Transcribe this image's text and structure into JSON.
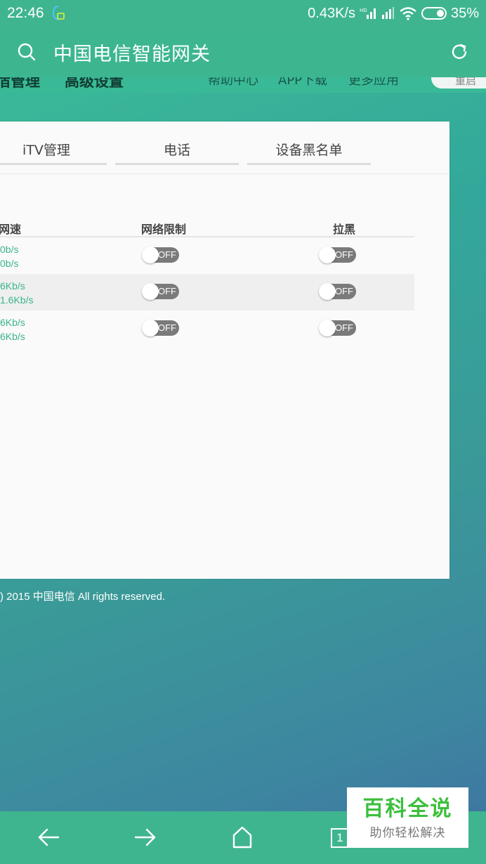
{
  "status_bar": {
    "time": "22:46",
    "net_speed": "0.43K/s",
    "battery": "35%"
  },
  "address_bar": {
    "title": "中国电信智能网关"
  },
  "page_nav": {
    "items": [
      "宿管理",
      "高级设置",
      "帮助中心",
      "APP下载",
      "更多应用"
    ],
    "pill": "重启"
  },
  "tabs": [
    "iTV管理",
    "电话",
    "设备黑名单"
  ],
  "table": {
    "headers": {
      "speed": "网速",
      "limit": "网络限制",
      "block": "拉黑"
    },
    "rows": [
      {
        "speed_up": "0b/s",
        "speed_down": "0b/s",
        "limit": "OFF",
        "block": "OFF"
      },
      {
        "speed_up": "6Kb/s",
        "speed_down": "1.6Kb/s",
        "limit": "OFF",
        "block": "OFF"
      },
      {
        "speed_up": "6Kb/s",
        "speed_down": "6Kb/s",
        "limit": "OFF",
        "block": "OFF"
      }
    ]
  },
  "footer": {
    "copyright": ") 2015 中国电信 All rights reserved."
  },
  "bottom_nav": {
    "tab_count": "1"
  },
  "watermark": {
    "title": "百科全说",
    "subtitle": "助你轻松解决"
  },
  "colors": {
    "accent": "#3fb58f",
    "speed_text": "#3bb48c",
    "switch_off": "#7a7a7a"
  }
}
